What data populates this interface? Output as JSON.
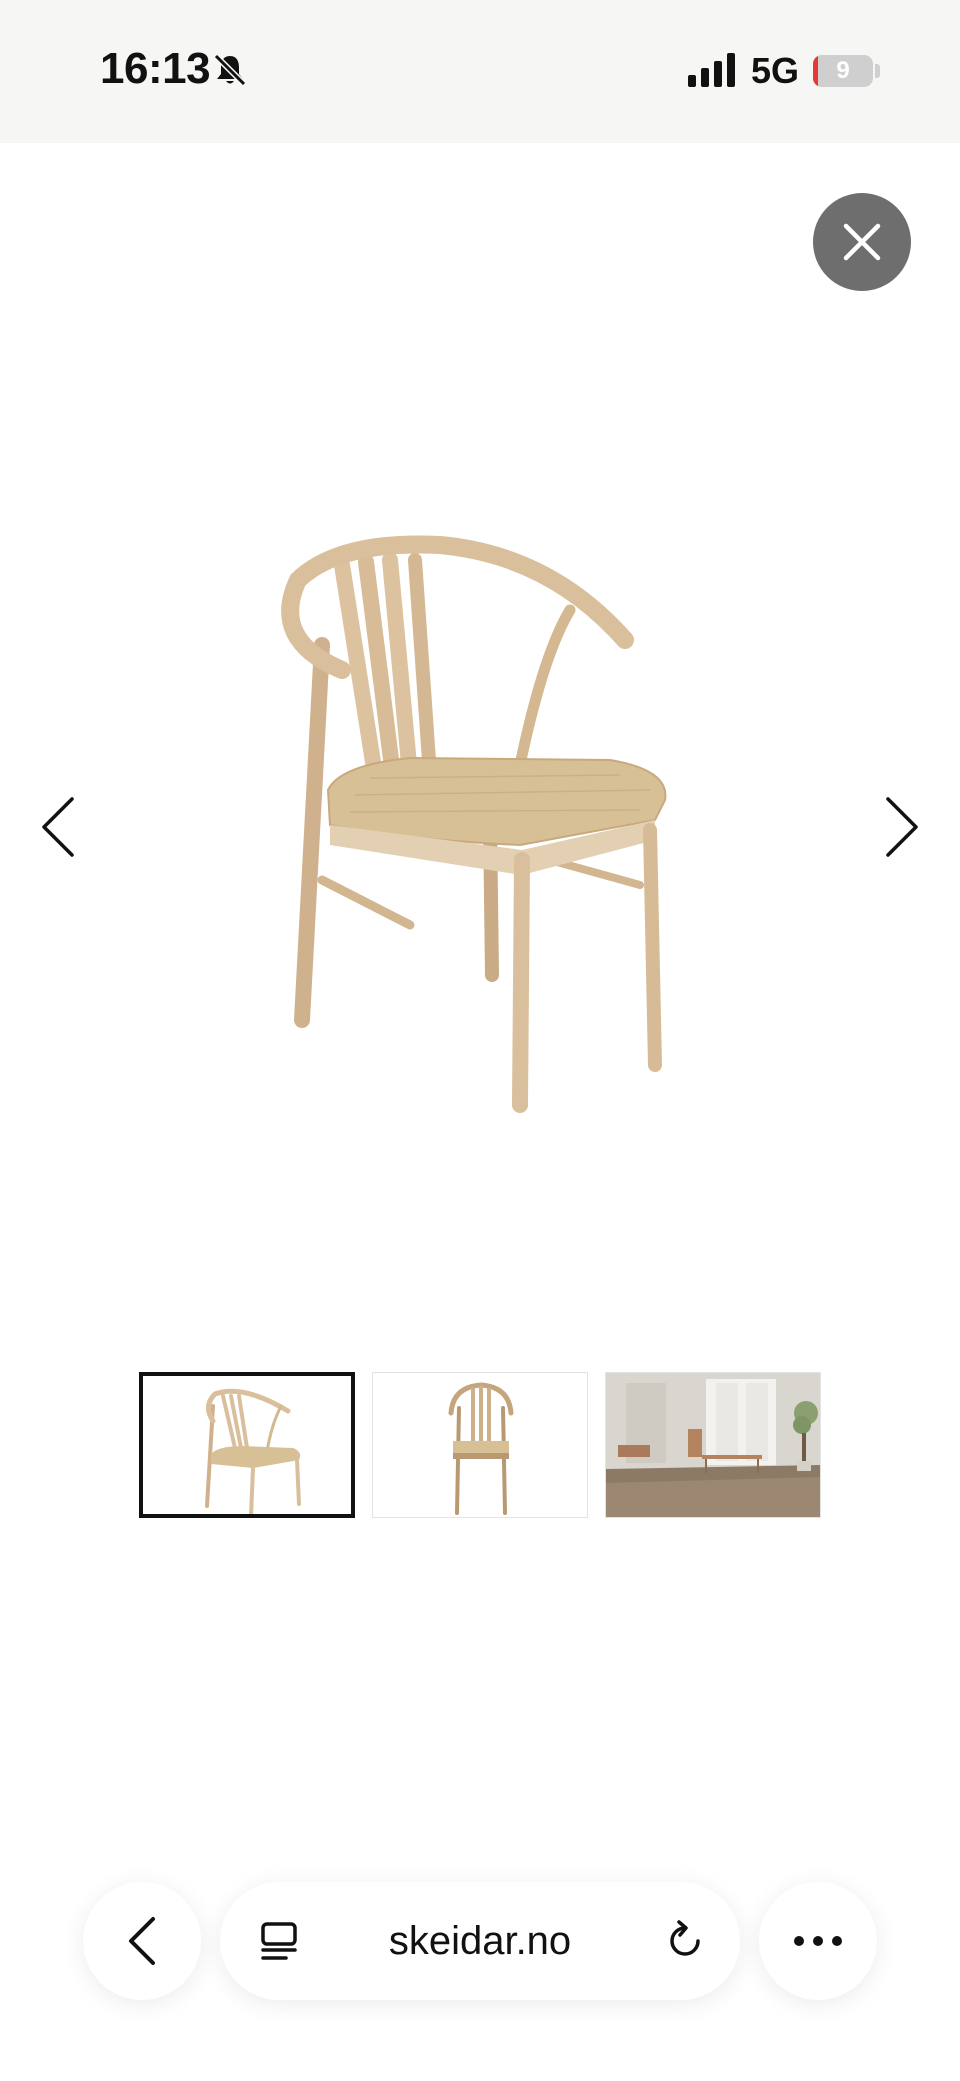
{
  "status_bar": {
    "time": "16:13",
    "network": "5G",
    "battery": 9
  },
  "viewer": {
    "close_icon": "close-icon",
    "prev_icon": "chevron-left-icon",
    "next_icon": "chevron-right-icon",
    "selected_index": 0,
    "thumbnails": [
      {
        "name": "chair-angle-view"
      },
      {
        "name": "chair-front-view"
      },
      {
        "name": "dining-room-scene"
      }
    ]
  },
  "browser": {
    "url": "skeidar.no",
    "back_icon": "chevron-left-icon",
    "tabs_icon": "tabs-icon",
    "reload_icon": "reload-icon",
    "more_icon": "more-icon"
  },
  "colors": {
    "status_bg": "#f6f6f4",
    "battery_low": "#e53935",
    "close_bg": "#6e6e6e",
    "wood": "#d9bf9b",
    "seat": "#d8c096"
  }
}
